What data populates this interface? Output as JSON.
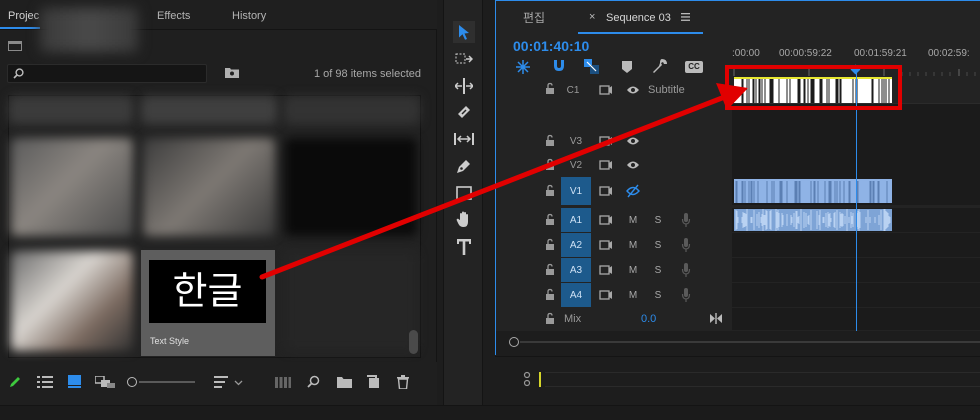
{
  "project_panel": {
    "tabs": [
      "Projec",
      "Effects",
      "History"
    ],
    "items_selected": "1 of 98 items selected",
    "selected_clip_text": "한글",
    "selected_clip_label": "Text Style"
  },
  "timeline": {
    "tabs": [
      "편집",
      "Sequence 03"
    ],
    "timecode": "00:01:40:10",
    "ruler_labels": [
      ":00:00",
      "00:00:59:22",
      "00:01:59:21",
      "00:02:59:"
    ],
    "caption_track": {
      "label": "C1",
      "name": "Subtitle"
    },
    "tracks": [
      {
        "label": "V3",
        "type": "video"
      },
      {
        "label": "V2",
        "type": "video"
      },
      {
        "label": "V1",
        "type": "video"
      },
      {
        "label": "A1",
        "type": "audio",
        "m": "M",
        "s": "S"
      },
      {
        "label": "A2",
        "type": "audio",
        "m": "M",
        "s": "S"
      },
      {
        "label": "A3",
        "type": "audio",
        "m": "M",
        "s": "S"
      },
      {
        "label": "A4",
        "type": "audio",
        "m": "M",
        "s": "S"
      }
    ],
    "mix": {
      "label": "Mix",
      "value": "0.0"
    },
    "cc_label": "CC"
  },
  "colors": {
    "accent": "#2d8ceb",
    "annotation": "#e10000",
    "caption_clip": "#ffffff",
    "video_clip": "#8fb3e6"
  }
}
